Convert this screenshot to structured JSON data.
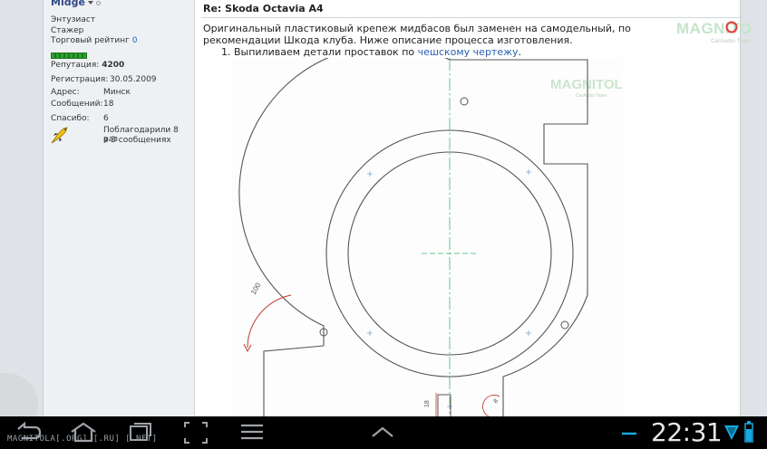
{
  "user": {
    "name": "Midge",
    "rank": "Энтузиаст",
    "status": "Стажер",
    "trade_label": "Торговый рейтинг",
    "trade_value": "0",
    "reputation_label": "Репутация:",
    "reputation_value": "4200",
    "registration_label": "Регистрация:",
    "registration_value": "30.05.2009",
    "address_label": "Адрес:",
    "address_value": "Минск",
    "messages_label": "Сообщений:",
    "messages_value": "18",
    "thanks_label": "Спасибо:",
    "thanks_value": "6",
    "thanked_line1": "Поблагодарили 8 раз",
    "thanked_line2": "в 3 сообщениях"
  },
  "post": {
    "title": "Re: Skoda Octavia A4",
    "body": "Оригинальный пластиковый крепеж мидбасов был заменен на самодельный, по рекомендации Шкода клуба. Ниже описание процесса изготовления.",
    "step_number": "1.",
    "step_text": "Выпиливаем детали проставок по",
    "step_link": "чешскому чертежу",
    "step_end": "."
  },
  "watermark": {
    "logo_text": "MAGNITOLA",
    "sub_text": "CarAudio Team"
  },
  "drawing": {
    "dim_radius": "100",
    "dim_height": "18",
    "dim_small": "8"
  },
  "system_bar": {
    "footer_url": "MAGNITOLA[.ORG] [.RU] [.NET]",
    "clock": "22:31"
  },
  "colors": {
    "accent_red": "#d0202a",
    "link_blue": "#2a5db0",
    "drawing_green": "#3cb371",
    "drawing_red": "#c0392b"
  }
}
